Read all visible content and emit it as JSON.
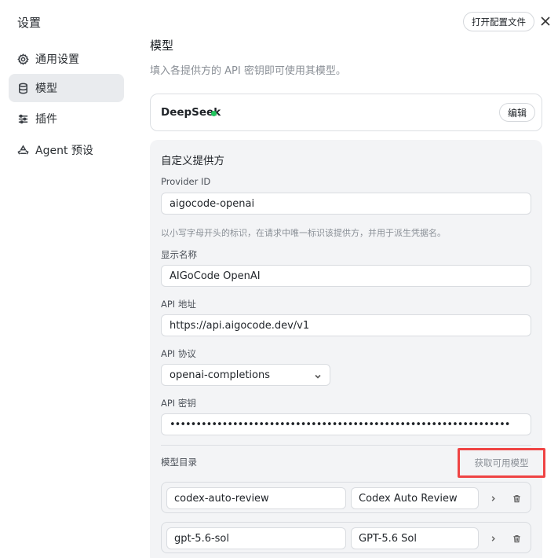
{
  "window": {
    "title": "设置"
  },
  "header": {
    "open_config_label": "打开配置文件"
  },
  "sidebar": {
    "items": [
      {
        "label": "通用设置",
        "icon": "gear-icon"
      },
      {
        "label": "模型",
        "icon": "database-icon"
      },
      {
        "label": "插件",
        "icon": "sliders-icon"
      },
      {
        "label": "Agent 预设",
        "icon": "recycle-icon"
      }
    ],
    "active_index": 1
  },
  "main": {
    "title": "模型",
    "description": "填入各提供方的 API 密钥即可使用其模型。",
    "provider": {
      "name": "DeepSeek",
      "status_color": "#22c55e",
      "edit_label": "编辑"
    },
    "custom": {
      "title": "自定义提供方",
      "provider_id": {
        "label": "Provider ID",
        "value": "aigocode-openai",
        "hint": "以小写字母开头的标识，在请求中唯一标识该提供方，并用于派生凭据名。"
      },
      "display_name": {
        "label": "显示名称",
        "value": "AIGoCode OpenAI"
      },
      "api_url": {
        "label": "API 地址",
        "value": "https://api.aigocode.dev/v1"
      },
      "api_protocol": {
        "label": "API 协议",
        "value": "openai-completions"
      },
      "api_key": {
        "label": "API 密钥",
        "value": "•••••••••••••••••••••••••••••••••••••••••••••••••••••••••••••••••"
      },
      "catalog": {
        "label": "模型目录",
        "fetch_label": "获取可用模型",
        "models": [
          {
            "id": "codex-auto-review",
            "name": "Codex Auto Review"
          },
          {
            "id": "gpt-5.6-sol",
            "name": "GPT-5.6 Sol"
          }
        ]
      }
    }
  },
  "colors": {
    "accent_highlight": "#ef4444",
    "active_nav_bg": "#e9ebee"
  }
}
